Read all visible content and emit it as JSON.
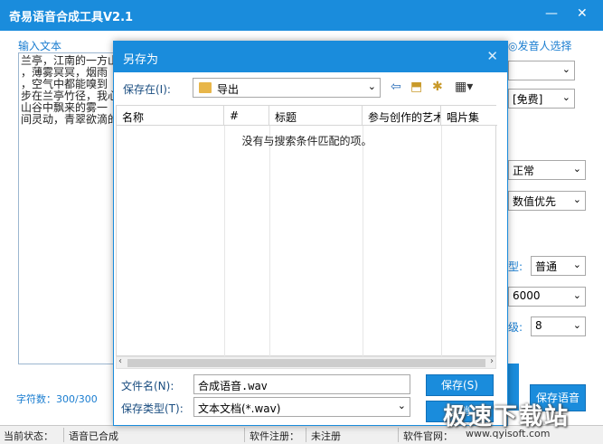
{
  "app": {
    "title": "奇易语音合成工具V2.1",
    "minimize_icon": "minimize-icon",
    "close_icon": "close-icon"
  },
  "left": {
    "input_label": "输入文本",
    "text": "兰亭，江南的一方山\n，薄雾冥冥，烟雨\n，空气中都能嗅到\n步在兰亭竹径，我心\n山谷中飘来的雾一\n间灵动，青翠欲滴的",
    "char_count": "字符数：300/300"
  },
  "right": {
    "partial_label": "◎发音人选择",
    "select1": "",
    "select2": "[免费]",
    "select3": "正常",
    "select4": "数值优先",
    "type_label": "型:",
    "type_value": "普通",
    "rate_value": "6000",
    "level_label": "级:",
    "level_value": "8",
    "save_voice": "保存语音"
  },
  "dialog": {
    "title": "另存为",
    "save_in_label": "保存在(I):",
    "location": "导出",
    "columns": [
      "名称",
      "#",
      "标题",
      "参与创作的艺术",
      "唱片集"
    ],
    "empty_message": "没有与搜索条件匹配的项。",
    "filename_label": "文件名(N):",
    "filename_value": "合成语音.wav",
    "filetype_label": "保存类型(T):",
    "filetype_value": "文本文档(*.wav)",
    "save_button": "保存(S)",
    "cancel_button": "取消"
  },
  "status": {
    "current_label": "当前状态：",
    "current_value": "语音已合成",
    "reg_label": "软件注册：",
    "reg_value": "未注册",
    "site_label": "软件官网："
  },
  "watermark": {
    "text": "极速下载站",
    "url": "www.qyisoft.com"
  }
}
